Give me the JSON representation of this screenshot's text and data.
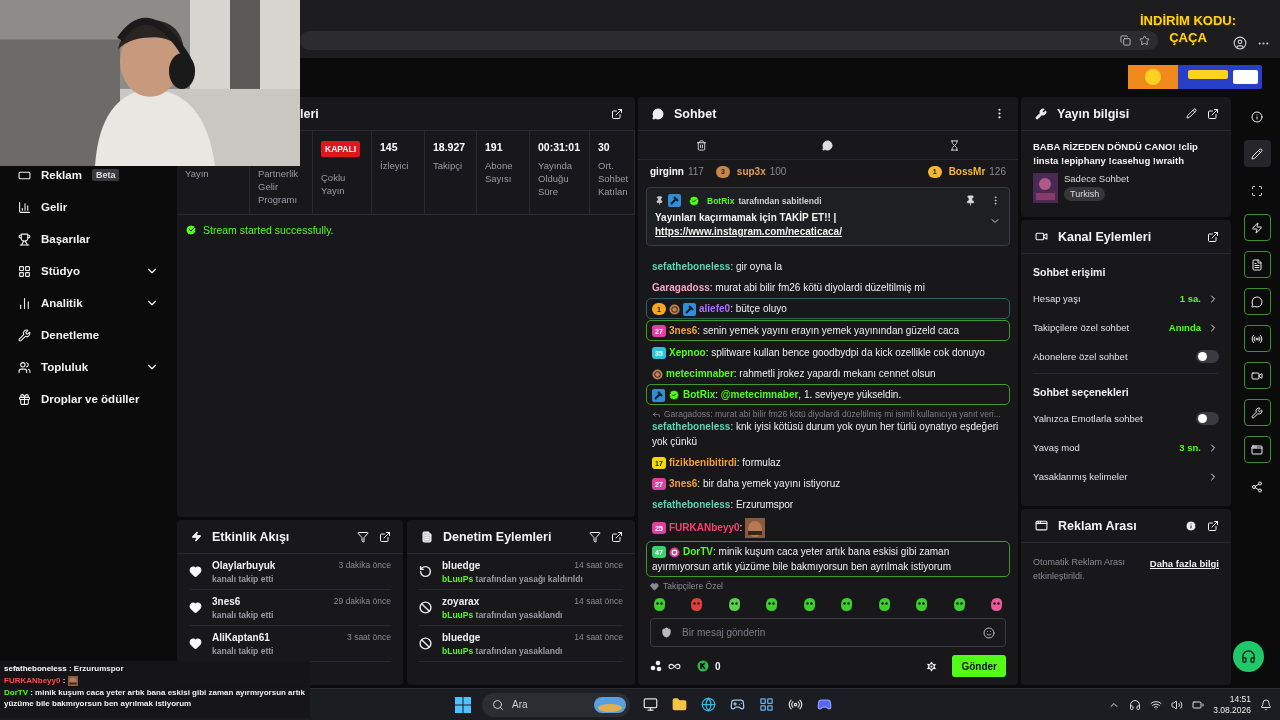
{
  "promo_overlay": {
    "lines": [
      "İNDİRİM KODU:",
      "ÇAÇA"
    ]
  },
  "sidebar": {
    "items": [
      {
        "label": "Reklam",
        "badge": "Beta",
        "expandable": false
      },
      {
        "label": "Gelir",
        "expandable": false
      },
      {
        "label": "Başarılar",
        "expandable": false
      },
      {
        "label": "Stüdyo",
        "expandable": true
      },
      {
        "label": "Analitik",
        "expandable": true
      },
      {
        "label": "Denetleme",
        "expandable": false
      },
      {
        "label": "Topluluk",
        "expandable": true
      },
      {
        "label": "Droplar ve ödüller",
        "expandable": false
      }
    ]
  },
  "stream_panel": {
    "title": "leri",
    "stats": [
      {
        "label": "Yayın"
      },
      {
        "label": "Partnerlik Gelir Programı"
      },
      {
        "badge": "KAPALI",
        "label": "Çoklu Yayın"
      },
      {
        "value": "145",
        "label": "İzleyici"
      },
      {
        "value": "18.927",
        "label": "Takipçi"
      },
      {
        "value": "191",
        "label": "Abone Sayısı"
      },
      {
        "value": "00:31:01",
        "label": "Yayında Olduğu Süre"
      },
      {
        "value": "30",
        "label": "Ort. Sohbet Katılan"
      }
    ],
    "status": "Stream started successfully."
  },
  "activity_feed": {
    "title": "Etkinlik Akışı",
    "rows": [
      {
        "name": "Olaylarbuyuk",
        "time": "3 dakika önce",
        "detail": "kanalı takip etti"
      },
      {
        "name": "3nes6",
        "time": "29 dakika önce",
        "detail": "kanalı takip etti"
      },
      {
        "name": "AliKaptan61",
        "time": "3 saat önce",
        "detail": "kanalı takip etti"
      }
    ]
  },
  "mod_actions": {
    "title": "Denetim Eylemleri",
    "rows": [
      {
        "kind": "unban",
        "name": "bluedge",
        "time": "14 saat önce",
        "actor": "bLuuPs",
        "detail": "tarafından yasağı kaldırıldı"
      },
      {
        "kind": "ban",
        "name": "zoyarax",
        "time": "14 saat önce",
        "actor": "bLuuPs",
        "detail": "tarafından yasaklandı"
      },
      {
        "kind": "ban",
        "name": "bluedge",
        "time": "14 saat önce",
        "actor": "bLuuPs",
        "detail": "tarafından yasaklandı"
      }
    ]
  },
  "chat": {
    "title": "Sohbet",
    "leaderboard": [
      {
        "name": "girginn",
        "count": "117",
        "color": "#ffffff"
      },
      {
        "name": "sup3x",
        "count": "100",
        "badge": "3",
        "color": "#e0a050"
      },
      {
        "name": "BossMr",
        "count": "126",
        "badge": "1",
        "color": "#f5b82e"
      }
    ],
    "pinned": {
      "by": "BotRix",
      "label": "tarafından sabitlendi",
      "text": "Yayınları kaçırmamak için TAKİP ET!! |",
      "link": "https://www.instagram.com/necaticaca/"
    },
    "messages": [
      {
        "user": "sefatheboneless",
        "color": "#5fd3b4",
        "text": ": gir oyna la"
      },
      {
        "user": "Garagadoss",
        "color": "#f2a7c3",
        "text": ": murat abi bilir fm26 kötü diyolardi düzeltilmiş mi"
      },
      {
        "user": "aliefe0",
        "color": "#a970ff",
        "text": ": bütçe oluyo",
        "highlight": {
          "color": "#2b6068"
        },
        "badges": [
          {
            "kind": "rank",
            "label": "1",
            "color": "#f5a623"
          },
          {
            "kind": "coin"
          },
          {
            "kind": "mod"
          }
        ]
      },
      {
        "user": "3nes6",
        "color": "#f0a23a",
        "text": ": senin yemek yayını erayın yemek yayınından güzeld caca",
        "highlight": {
          "color": "#3f9a2a"
        },
        "badges": [
          {
            "kind": "level",
            "label": "27",
            "color": "#e040a0"
          }
        ]
      },
      {
        "user": "Xepnoo",
        "color": "#53fc18",
        "text": ": splitware kullan bence goodbydpi da kick ozellikle cok donuyo",
        "badges": [
          {
            "kind": "level",
            "label": "35",
            "color": "#2ec4d6"
          }
        ]
      },
      {
        "user": "metecimnaber",
        "color": "#53fc18",
        "text": ": rahmetli jrokez yapardı mekanı cennet olsun",
        "badges": [
          {
            "kind": "coin"
          }
        ]
      },
      {
        "user": "BotRix",
        "color": "#53fc18",
        "text": ": ",
        "mention": "@metecimnaber",
        "rest": ", 1. seviyeye yükseldin.",
        "highlight": {
          "color": "#3f9a2a"
        },
        "badges": [
          {
            "kind": "mod"
          },
          {
            "kind": "verified"
          }
        ]
      },
      {
        "user": "sefatheboneless",
        "color": "#5fd3b4",
        "reply": "Garagadoss: murat abi bilir fm26 kötü diyolardi düzeltilmiş mi isimli kullanıcıya yanıt veri...",
        "text": ": knk iyisi kötüsü durum yok oyun her türlü oynatıyo eşdeğeri yok çünkü"
      },
      {
        "user": "fizikbenibitirdi",
        "color": "#f0a23a",
        "text": ": formulaz",
        "badges": [
          {
            "kind": "level",
            "label": "17",
            "color": "#f5d90a"
          }
        ]
      },
      {
        "user": "3nes6",
        "color": "#f0a23a",
        "text": ": bir daha yemek yayını istiyoruz",
        "badges": [
          {
            "kind": "level",
            "label": "27",
            "color": "#e040a0"
          }
        ]
      },
      {
        "user": "sefatheboneless",
        "color": "#5fd3b4",
        "text": ": Erzurumspor"
      },
      {
        "user": "FURKANbeyy0",
        "color": "#ff3d6e",
        "text": ":",
        "emote": true,
        "badges": [
          {
            "kind": "level",
            "label": "25",
            "color": "#e040a0"
          }
        ]
      },
      {
        "user": "DorTV",
        "color": "#53fc18",
        "text": ": minik kuşum caca yeter artık bana eskisi gibi zaman ayırmıyorsun artık yüzüme bile bakmıyorsun ben ayrılmak istiyorum",
        "highlight": {
          "color": "#3f9a2a"
        },
        "badges": [
          {
            "kind": "level",
            "label": "47",
            "color": "#3ccf6e"
          },
          {
            "kind": "sub"
          }
        ]
      }
    ],
    "emote_section": "Takipçilere Özel",
    "input": {
      "placeholder": "Bir mesaj gönderin"
    },
    "points": "0",
    "send": "Gönder"
  },
  "stream_info": {
    "title": "Yayın bilgisi",
    "stream_title": "BABA RİZEDEN DÖNDÜ CANO! !clip !insta !epiphany !casehug !wraith",
    "category": "Sadece Sohbet",
    "tag": "Turkish"
  },
  "channel_actions": {
    "title": "Kanal Eylemleri",
    "sections": [
      {
        "title": "Sohbet erişimi",
        "rows": [
          {
            "kind": "value",
            "label": "Hesap yaşı",
            "value": "1 sa."
          },
          {
            "kind": "value",
            "label": "Takipçilere özel sohbet",
            "value": "Anında"
          },
          {
            "kind": "toggle",
            "label": "Abonelere özel sohbet",
            "on": false
          }
        ]
      },
      {
        "title": "Sohbet seçenekleri",
        "rows": [
          {
            "kind": "toggle",
            "label": "Yalnızca Emotlarla sohbet",
            "on": false
          },
          {
            "kind": "value",
            "label": "Yavaş mod",
            "value": "3 sn."
          },
          {
            "kind": "link",
            "label": "Yasaklanmış kelimeler"
          }
        ]
      }
    ]
  },
  "ad_break": {
    "title": "Reklam Arası",
    "text": "Otomatik Reklam Arası etkinleştirildi.",
    "link": "Daha fazla bilgi"
  },
  "rail": [
    {
      "active": false,
      "selected": false
    },
    {
      "active": false,
      "selected": true
    },
    {
      "active": false,
      "selected": false
    },
    {
      "active": true,
      "selected": false
    },
    {
      "active": true,
      "selected": false
    },
    {
      "active": true,
      "selected": false
    },
    {
      "active": true,
      "selected": false
    },
    {
      "active": true,
      "selected": false
    },
    {
      "active": true,
      "selected": false
    },
    {
      "active": true,
      "selected": false
    },
    {
      "active": false,
      "selected": false
    }
  ],
  "chat_overlay": [
    {
      "user": "sefatheboneless",
      "color": "#ffffff",
      "text": ": Erzurumspor"
    },
    {
      "user": "FURKANbeyy0",
      "color": "#ff4d4d",
      "text": ":",
      "emote": true
    },
    {
      "user": "DorTV",
      "color": "#53fc18",
      "text": ": minik kuşum caca yeter artık bana eskisi gibi zaman ayırmıyorsun artık yüzüme bile bakmıyorsun ben ayrılmak istiyorum"
    }
  ],
  "taskbar": {
    "search": {
      "placeholder": "Ara"
    },
    "time": "14:51",
    "date": "3.08.2026"
  }
}
